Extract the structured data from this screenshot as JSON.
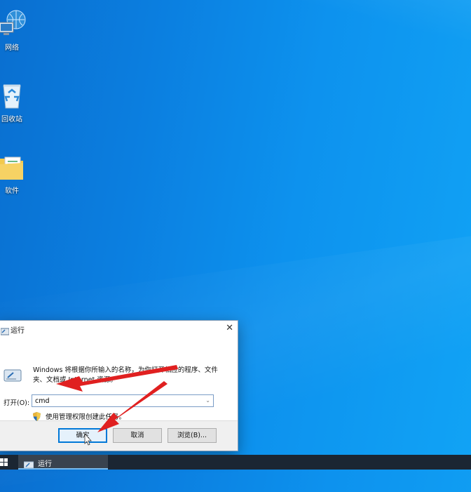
{
  "desktop": {
    "icons": [
      {
        "label": "网络",
        "icon": "network-icon"
      },
      {
        "label": "回收站",
        "icon": "recycle-bin-icon"
      },
      {
        "label": "软件",
        "icon": "folder-icon"
      }
    ]
  },
  "run_dialog": {
    "title": "运行",
    "description": "Windows 将根据你所输入的名称，为你打开相应的程序、文件夹、文档或 Internet 资源。",
    "open_label": "打开(O):",
    "open_value": "cmd",
    "admin_note": "使用管理权限创建此任务。",
    "buttons": {
      "ok": "确定",
      "cancel": "取消",
      "browse": "浏览(B)..."
    }
  },
  "taskbar": {
    "active_item": "运行"
  },
  "colors": {
    "desktop_blue": "#0b7fe0",
    "taskbar": "#1b2633",
    "annotation_arrow": "#e02020",
    "focus_border": "#0078d7"
  }
}
